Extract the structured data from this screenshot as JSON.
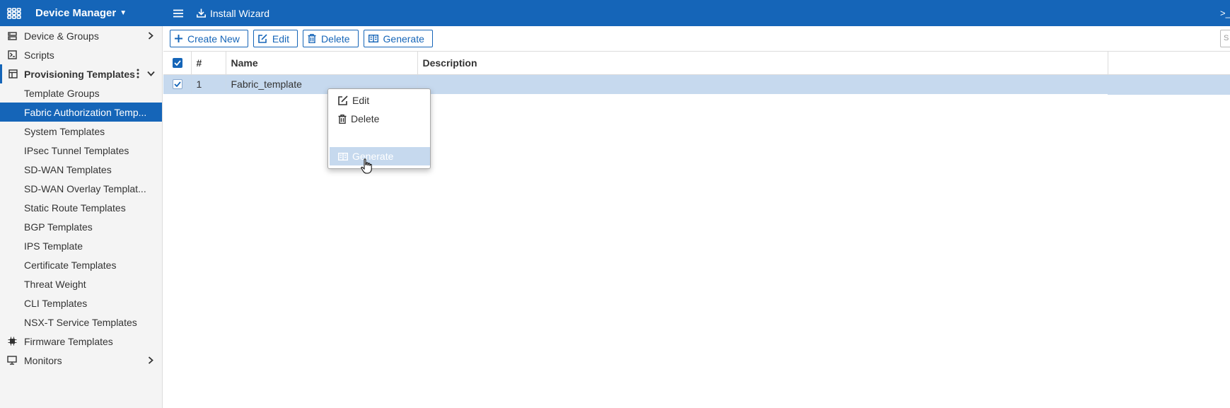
{
  "topbar": {
    "app_title": "Device Manager",
    "install_wizard": "Install Wizard",
    "cli_glyph": ">_"
  },
  "sidebar": {
    "items": [
      {
        "label": "Device & Groups",
        "icon": "device-groups-icon"
      },
      {
        "label": "Scripts",
        "icon": "scripts-icon"
      },
      {
        "label": "Provisioning Templates",
        "icon": "provisioning-templates-icon"
      },
      {
        "label": "Template Groups"
      },
      {
        "label": "Fabric Authorization Temp..."
      },
      {
        "label": "System Templates"
      },
      {
        "label": "IPsec Tunnel Templates"
      },
      {
        "label": "SD-WAN Templates"
      },
      {
        "label": "SD-WAN Overlay Templat..."
      },
      {
        "label": "Static Route Templates"
      },
      {
        "label": "BGP Templates"
      },
      {
        "label": "IPS Template"
      },
      {
        "label": "Certificate Templates"
      },
      {
        "label": "Threat Weight"
      },
      {
        "label": "CLI Templates"
      },
      {
        "label": "NSX-T Service Templates"
      },
      {
        "label": "Firmware Templates",
        "icon": "firmware-templates-icon"
      },
      {
        "label": "Monitors",
        "icon": "monitors-icon"
      }
    ]
  },
  "toolbar": {
    "create_new": "Create New",
    "edit": "Edit",
    "delete": "Delete",
    "generate": "Generate",
    "search_stub": "S"
  },
  "table": {
    "headers": [
      "#",
      "Name",
      "Description"
    ],
    "rows": [
      {
        "index": "1",
        "name": "Fabric_template",
        "description": ""
      }
    ]
  },
  "context_menu": {
    "edit": "Edit",
    "delete": "Delete",
    "generate": "Generate"
  },
  "colors": {
    "brand_blue": "#1565b8",
    "selected_row": "#c6d9ee"
  }
}
